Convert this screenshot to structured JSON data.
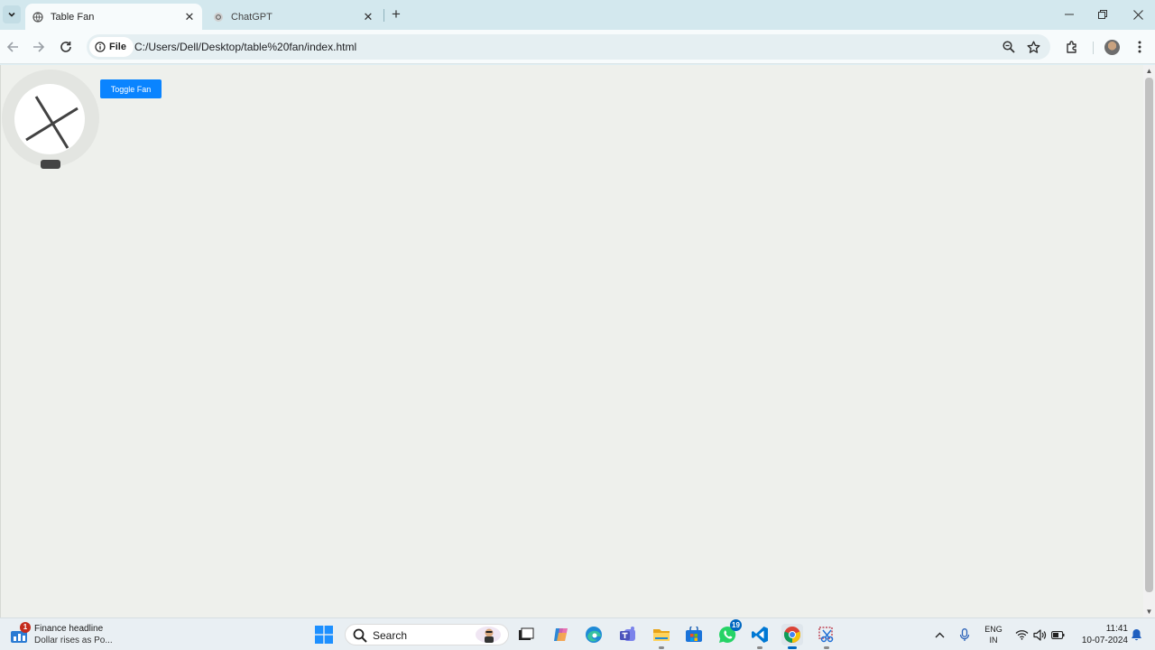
{
  "browser": {
    "tabs": [
      {
        "title": "Table Fan",
        "active": true
      },
      {
        "title": "ChatGPT",
        "active": false
      }
    ],
    "address": {
      "chip_label": "File",
      "url": "C:/Users/Dell/Desktop/table%20fan/index.html"
    }
  },
  "page": {
    "toggle_button_label": "Toggle Fan",
    "fan_color": "#ffffff",
    "button_color": "#0a84ff"
  },
  "taskbar": {
    "widget": {
      "badge": "1",
      "title": "Finance headline",
      "subtitle": "Dollar rises as Po..."
    },
    "search_label": "Search",
    "whatsapp_badge": "19",
    "tray": {
      "lang_line1": "ENG",
      "lang_line2": "IN",
      "time": "11:41",
      "date": "10-07-2024"
    }
  }
}
